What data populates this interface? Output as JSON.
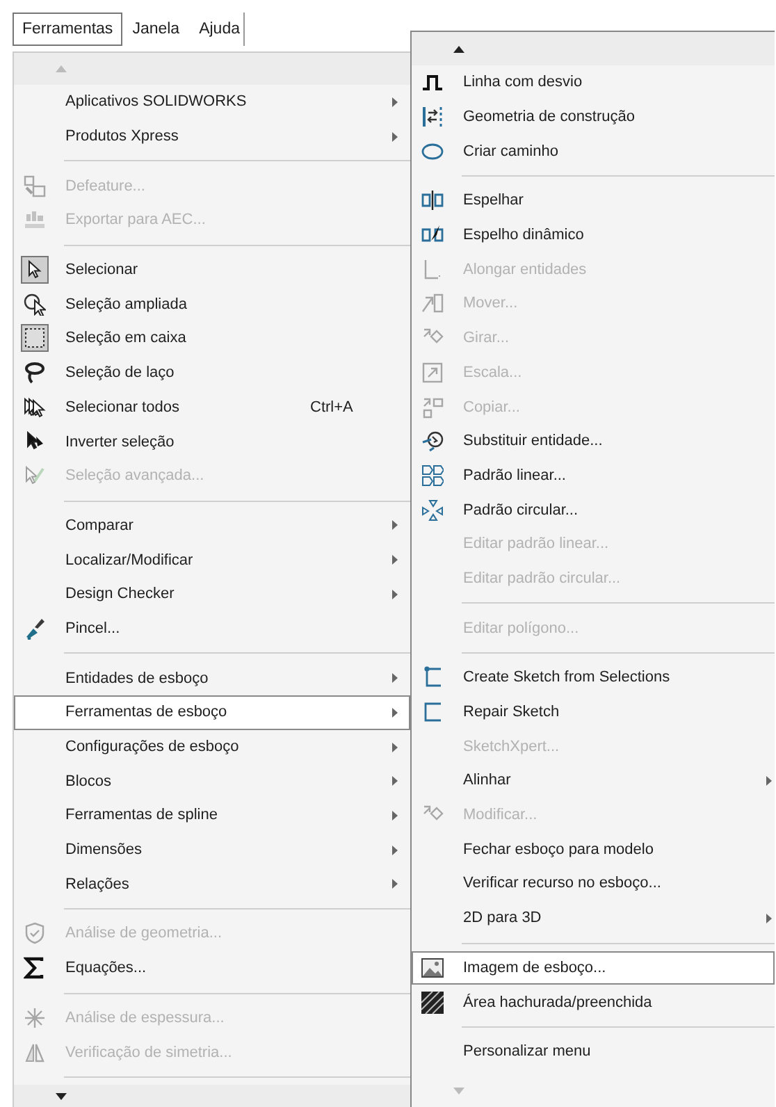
{
  "menubar": {
    "items": [
      {
        "label": "Ferramentas",
        "selected": true
      },
      {
        "label": "Janela",
        "selected": false
      },
      {
        "label": "Ajuda",
        "selected": false
      }
    ]
  },
  "main_menu": {
    "scroll_up": {
      "disabled": true
    },
    "scroll_down": {
      "disabled": false
    },
    "items": [
      {
        "kind": "item",
        "label": "Aplicativos SOLIDWORKS",
        "disabled": false,
        "selected": false,
        "checked": false,
        "submenu": true
      },
      {
        "kind": "item",
        "label": "Produtos Xpress",
        "disabled": false,
        "selected": false,
        "checked": false,
        "submenu": true
      },
      {
        "kind": "separator"
      },
      {
        "kind": "item",
        "label": "Defeature...",
        "disabled": true,
        "selected": false,
        "checked": false,
        "submenu": false
      },
      {
        "kind": "item",
        "label": "Exportar para AEC...",
        "disabled": true,
        "selected": false,
        "checked": false,
        "submenu": false
      },
      {
        "kind": "separator"
      },
      {
        "kind": "item",
        "label": "Selecionar",
        "disabled": false,
        "selected": false,
        "checked": true,
        "submenu": false
      },
      {
        "kind": "item",
        "label": "Seleção ampliada",
        "disabled": false,
        "selected": false,
        "checked": false,
        "submenu": false
      },
      {
        "kind": "item",
        "label": "Seleção em caixa",
        "disabled": false,
        "selected": false,
        "checked": true,
        "submenu": false
      },
      {
        "kind": "item",
        "label": "Seleção de laço",
        "disabled": false,
        "selected": false,
        "checked": false,
        "submenu": false
      },
      {
        "kind": "item",
        "label": "Selecionar todos",
        "shortcut": "Ctrl+A",
        "disabled": false,
        "selected": false,
        "checked": false,
        "submenu": false
      },
      {
        "kind": "item",
        "label": "Inverter seleção",
        "disabled": false,
        "selected": false,
        "checked": false,
        "submenu": false
      },
      {
        "kind": "item",
        "label": "Seleção avançada...",
        "disabled": true,
        "selected": false,
        "checked": false,
        "submenu": false
      },
      {
        "kind": "separator"
      },
      {
        "kind": "item",
        "label": "Comparar",
        "disabled": false,
        "selected": false,
        "checked": false,
        "submenu": true
      },
      {
        "kind": "item",
        "label": "Localizar/Modificar",
        "disabled": false,
        "selected": false,
        "checked": false,
        "submenu": true
      },
      {
        "kind": "item",
        "label": "Design Checker",
        "disabled": false,
        "selected": false,
        "checked": false,
        "submenu": true
      },
      {
        "kind": "item",
        "label": "Pincel...",
        "disabled": false,
        "selected": false,
        "checked": false,
        "submenu": false
      },
      {
        "kind": "separator"
      },
      {
        "kind": "item",
        "label": "Entidades de esboço",
        "disabled": false,
        "selected": false,
        "checked": false,
        "submenu": true
      },
      {
        "kind": "item",
        "label": "Ferramentas de esboço",
        "disabled": false,
        "selected": true,
        "checked": false,
        "submenu": true
      },
      {
        "kind": "item",
        "label": "Configurações de esboço",
        "disabled": false,
        "selected": false,
        "checked": false,
        "submenu": true
      },
      {
        "kind": "item",
        "label": "Blocos",
        "disabled": false,
        "selected": false,
        "checked": false,
        "submenu": true
      },
      {
        "kind": "item",
        "label": "Ferramentas de spline",
        "disabled": false,
        "selected": false,
        "checked": false,
        "submenu": true
      },
      {
        "kind": "item",
        "label": "Dimensões",
        "disabled": false,
        "selected": false,
        "checked": false,
        "submenu": true
      },
      {
        "kind": "item",
        "label": "Relações",
        "disabled": false,
        "selected": false,
        "checked": false,
        "submenu": true
      },
      {
        "kind": "separator"
      },
      {
        "kind": "item",
        "label": "Análise de geometria...",
        "disabled": true,
        "selected": false,
        "checked": false,
        "submenu": false
      },
      {
        "kind": "item",
        "label": "Equações...",
        "disabled": false,
        "selected": false,
        "checked": false,
        "submenu": false
      },
      {
        "kind": "separator"
      },
      {
        "kind": "item",
        "label": "Análise de espessura...",
        "disabled": true,
        "selected": false,
        "checked": false,
        "submenu": false
      },
      {
        "kind": "item",
        "label": "Verificação de simetria...",
        "disabled": true,
        "selected": false,
        "checked": false,
        "submenu": false
      },
      {
        "kind": "separator"
      }
    ]
  },
  "submenu": {
    "scroll_up": {
      "disabled": false
    },
    "scroll_down": {
      "disabled": true
    },
    "items": [
      {
        "kind": "item",
        "label": "Linha com desvio",
        "disabled": false,
        "selected": false,
        "submenu": false
      },
      {
        "kind": "item",
        "label": "Geometria de construção",
        "disabled": false,
        "selected": false,
        "submenu": false
      },
      {
        "kind": "item",
        "label": "Criar caminho",
        "disabled": false,
        "selected": false,
        "submenu": false
      },
      {
        "kind": "separator"
      },
      {
        "kind": "item",
        "label": "Espelhar",
        "disabled": false,
        "selected": false,
        "submenu": false
      },
      {
        "kind": "item",
        "label": "Espelho dinâmico",
        "disabled": false,
        "selected": false,
        "submenu": false
      },
      {
        "kind": "item",
        "label": "Alongar entidades",
        "disabled": true,
        "selected": false,
        "submenu": false
      },
      {
        "kind": "item",
        "label": "Mover...",
        "disabled": true,
        "selected": false,
        "submenu": false
      },
      {
        "kind": "item",
        "label": "Girar...",
        "disabled": true,
        "selected": false,
        "submenu": false
      },
      {
        "kind": "item",
        "label": "Escala...",
        "disabled": true,
        "selected": false,
        "submenu": false
      },
      {
        "kind": "item",
        "label": "Copiar...",
        "disabled": true,
        "selected": false,
        "submenu": false
      },
      {
        "kind": "item",
        "label": "Substituir entidade...",
        "disabled": false,
        "selected": false,
        "submenu": false
      },
      {
        "kind": "item",
        "label": "Padrão linear...",
        "disabled": false,
        "selected": false,
        "submenu": false
      },
      {
        "kind": "item",
        "label": "Padrão circular...",
        "disabled": false,
        "selected": false,
        "submenu": false
      },
      {
        "kind": "item",
        "label": "Editar padrão linear...",
        "disabled": true,
        "selected": false,
        "submenu": false
      },
      {
        "kind": "item",
        "label": "Editar padrão circular...",
        "disabled": true,
        "selected": false,
        "submenu": false
      },
      {
        "kind": "separator"
      },
      {
        "kind": "item",
        "label": "Editar polígono...",
        "disabled": true,
        "selected": false,
        "submenu": false
      },
      {
        "kind": "separator"
      },
      {
        "kind": "item",
        "label": "Create Sketch from Selections",
        "disabled": false,
        "selected": false,
        "submenu": false
      },
      {
        "kind": "item",
        "label": "Repair Sketch",
        "disabled": false,
        "selected": false,
        "submenu": false
      },
      {
        "kind": "item",
        "label": "SketchXpert...",
        "disabled": true,
        "selected": false,
        "submenu": false
      },
      {
        "kind": "item",
        "label": "Alinhar",
        "disabled": false,
        "selected": false,
        "submenu": true
      },
      {
        "kind": "item",
        "label": "Modificar...",
        "disabled": true,
        "selected": false,
        "submenu": false
      },
      {
        "kind": "item",
        "label": "Fechar esboço para modelo",
        "disabled": false,
        "selected": false,
        "submenu": false
      },
      {
        "kind": "item",
        "label": "Verificar recurso no esboço...",
        "disabled": false,
        "selected": false,
        "submenu": false
      },
      {
        "kind": "item",
        "label": "2D para 3D",
        "disabled": false,
        "selected": false,
        "submenu": true
      },
      {
        "kind": "separator"
      },
      {
        "kind": "item",
        "label": "Imagem de esboço...",
        "disabled": false,
        "selected": true,
        "submenu": false
      },
      {
        "kind": "item",
        "label": "Área hachurada/preenchida",
        "disabled": false,
        "selected": false,
        "submenu": false
      },
      {
        "kind": "separator"
      },
      {
        "kind": "item",
        "label": "Personalizar menu",
        "disabled": false,
        "selected": false,
        "submenu": false
      }
    ]
  }
}
